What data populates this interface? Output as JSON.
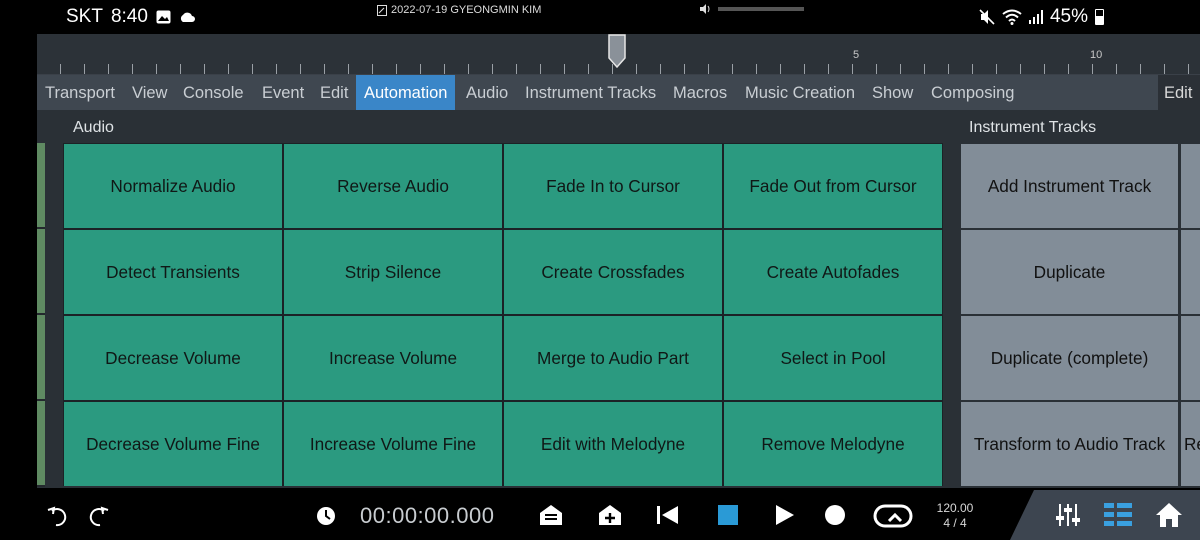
{
  "status_bar": {
    "carrier": "SKT",
    "time": "8:40",
    "notification": "2022-07-19 GYEONGMIN KIM",
    "battery": "45%"
  },
  "ruler": {
    "marks": [
      "5",
      "10"
    ]
  },
  "menu": {
    "items": [
      "Transport",
      "View",
      "Console",
      "Event",
      "Edit",
      "Automation",
      "Audio",
      "Instrument Tracks",
      "Macros",
      "Music Creation",
      "Show",
      "Composing"
    ],
    "active": "Automation",
    "edit_label": "Edit"
  },
  "sections": {
    "audio_title": "Audio",
    "instrument_title": "Instrument Tracks"
  },
  "audio_buttons": [
    "Normalize Audio",
    "Reverse Audio",
    "Fade In to Cursor",
    "Fade Out from Cursor",
    "Detect Transients",
    "Strip Silence",
    "Create Crossfades",
    "Create Autofades",
    "Decrease Volume",
    "Increase Volume",
    "Merge to Audio Part",
    "Select in Pool",
    "Decrease Volume Fine",
    "Increase Volume Fine",
    "Edit with Melodyne",
    "Remove Melodyne"
  ],
  "instrument_buttons": [
    "Add Instrument Track",
    "Duplicate",
    "Duplicate (complete)",
    "Transform to Audio Track"
  ],
  "instrument_partial": [
    "",
    "",
    "",
    "Re"
  ],
  "toolbar": {
    "timecode": "00:00:00.000",
    "tempo": "120.00",
    "signature": "4 / 4"
  },
  "colors": {
    "audio_button": "#2b9a80",
    "instrument_button": "#828d98",
    "active_menu": "#3a86c8"
  }
}
